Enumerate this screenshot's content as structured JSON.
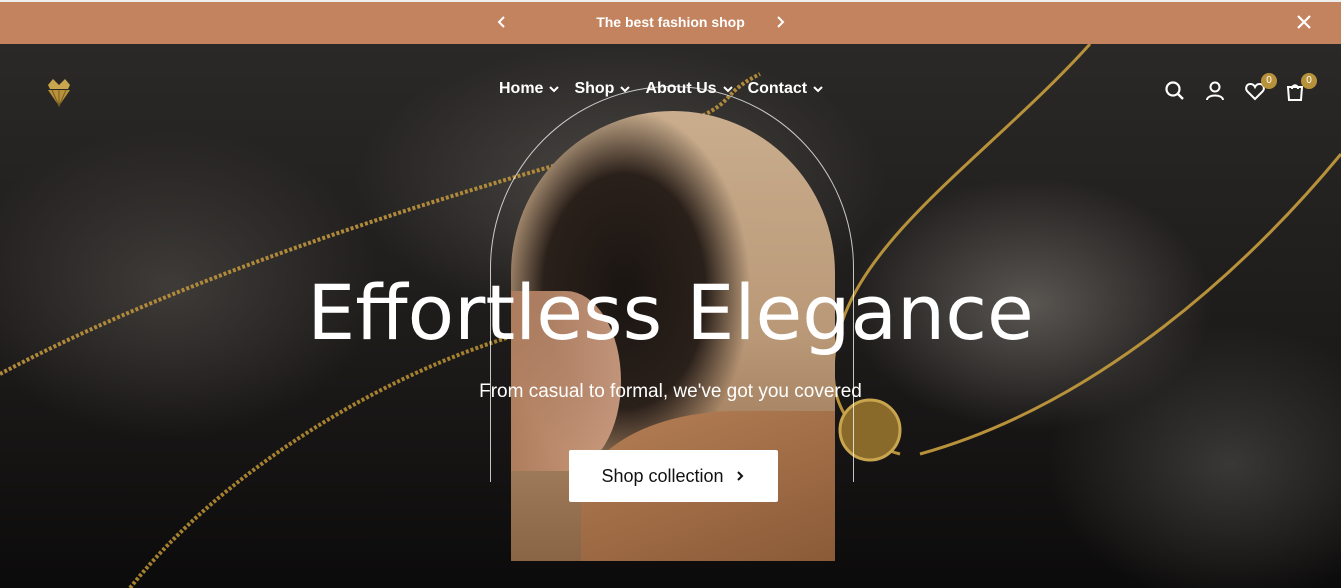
{
  "announcement": {
    "text": "The best fashion shop",
    "prev_icon": "chevron-left-icon",
    "next_icon": "chevron-right-icon",
    "close_icon": "close-icon",
    "background": "#c4835f"
  },
  "header": {
    "logo_icon": "crown-diamond-logo",
    "nav": [
      {
        "label": "Home"
      },
      {
        "label": "Shop"
      },
      {
        "label": "About Us"
      },
      {
        "label": "Contact"
      }
    ],
    "wishlist_count": "0",
    "cart_count": "0",
    "badge_color": "#b8923a"
  },
  "hero": {
    "title": "Effortless Elegance",
    "subtitle": "From casual to formal, we've got you covered",
    "button_label": "Shop collection"
  }
}
